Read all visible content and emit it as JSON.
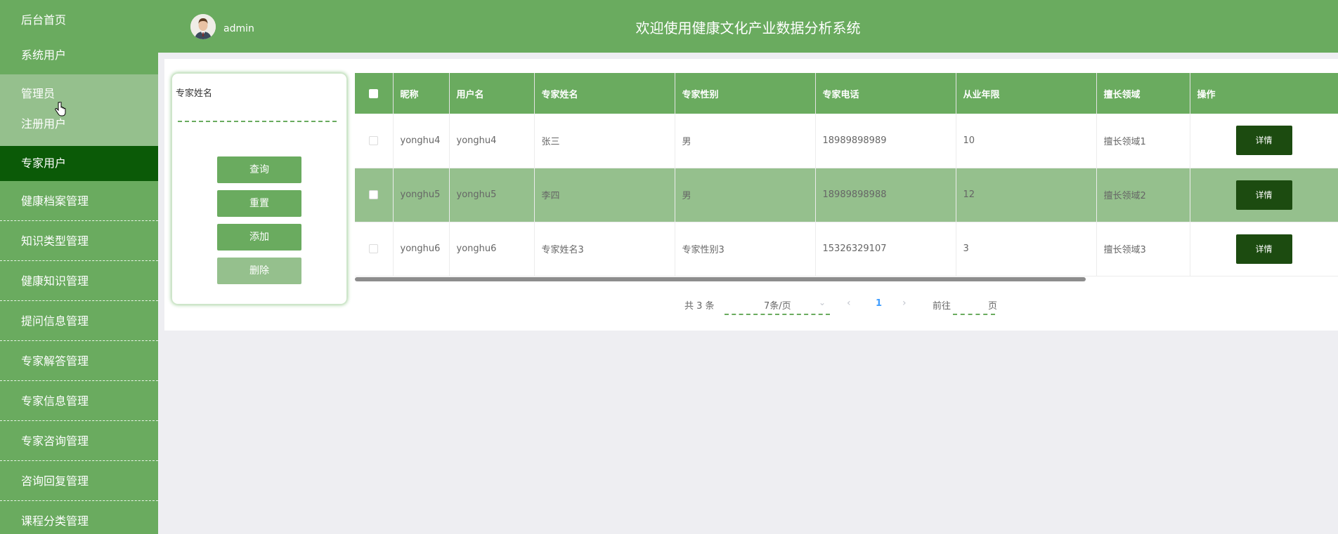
{
  "sidebar": {
    "items": [
      {
        "label": "后台首页"
      },
      {
        "label": "系统用户"
      },
      {
        "label": "管理员"
      },
      {
        "label": "注册用户"
      },
      {
        "label": "专家用户"
      },
      {
        "label": "健康档案管理"
      },
      {
        "label": "知识类型管理"
      },
      {
        "label": "健康知识管理"
      },
      {
        "label": "提问信息管理"
      },
      {
        "label": "专家解答管理"
      },
      {
        "label": "专家信息管理"
      },
      {
        "label": "专家咨询管理"
      },
      {
        "label": "咨询回复管理"
      },
      {
        "label": "课程分类管理"
      }
    ],
    "active_item": "专家用户"
  },
  "header": {
    "username": "admin",
    "title": "欢迎使用健康文化产业数据分析系统"
  },
  "search": {
    "label": "专家姓名",
    "value": "",
    "buttons": {
      "query": "查询",
      "reset": "重置",
      "add": "添加",
      "delete": "删除"
    }
  },
  "table": {
    "headers": [
      "昵称",
      "用户名",
      "专家姓名",
      "专家性别",
      "专家电话",
      "从业年限",
      "擅长领域",
      "操作"
    ],
    "rows": [
      {
        "nickname": "yonghu4",
        "username": "yonghu4",
        "name": "张三",
        "gender": "男",
        "phone": "18989898989",
        "years": "10",
        "field": "擅长领域1",
        "action": "详情"
      },
      {
        "nickname": "yonghu5",
        "username": "yonghu5",
        "name": "李四",
        "gender": "男",
        "phone": "18989898988",
        "years": "12",
        "field": "擅长领域2",
        "action": "详情"
      },
      {
        "nickname": "yonghu6",
        "username": "yonghu6",
        "name": "专家姓名3",
        "gender": "专家性别3",
        "phone": "15326329107",
        "years": "3",
        "field": "擅长领域3",
        "action": "详情"
      }
    ],
    "highlighted_row": 1
  },
  "pagination": {
    "total": "共 3 条",
    "page_size": "7条/页",
    "current_page": "1",
    "goto_label": "前往",
    "page_suffix": "页"
  },
  "colors": {
    "primary": "#6aab5f",
    "active": "#0b5a07",
    "highlight": "#95c08d",
    "detail_button": "#1c4b10"
  }
}
